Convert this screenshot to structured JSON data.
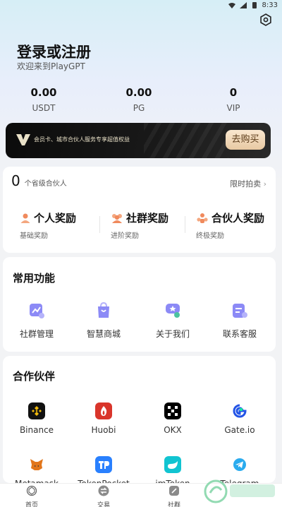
{
  "status_bar": {
    "time": "8:33"
  },
  "header": {
    "title": "登录或注册",
    "subtitle": "欢迎来到PlayGPT"
  },
  "stats": [
    {
      "value": "0.00",
      "label": "USDT"
    },
    {
      "value": "0.00",
      "label": "PG"
    },
    {
      "value": "0",
      "label": "VIP"
    }
  ],
  "banner": {
    "text": "会员卡、城市合伙人服务专享超值权益",
    "button": "去购买"
  },
  "partner": {
    "count": "0",
    "label": "个省级合伙人",
    "auction": "限时拍卖"
  },
  "rewards": [
    {
      "title": "个人奖励",
      "subtitle": "基础奖励",
      "icon": "person-icon"
    },
    {
      "title": "社群奖励",
      "subtitle": "进阶奖励",
      "icon": "group-icon"
    },
    {
      "title": "合伙人奖励",
      "subtitle": "终极奖励",
      "icon": "partners-icon"
    }
  ],
  "functions": {
    "title": "常用功能",
    "items": [
      {
        "label": "社群管理",
        "icon": "chart-icon"
      },
      {
        "label": "智慧商城",
        "icon": "shop-bag-icon"
      },
      {
        "label": "关于我们",
        "icon": "badge-icon"
      },
      {
        "label": "联系客服",
        "icon": "service-card-icon"
      }
    ]
  },
  "partners": {
    "title": "合作伙伴",
    "items": [
      {
        "label": "Binance",
        "icon": "binance-icon",
        "color": "#F0B90B"
      },
      {
        "label": "Huobi",
        "icon": "huobi-icon",
        "color": "#D9352B"
      },
      {
        "label": "OKX",
        "icon": "okx-icon",
        "color": "#000000"
      },
      {
        "label": "Gate.io",
        "icon": "gateio-icon",
        "color": "#2354E6"
      },
      {
        "label": "Metamask",
        "icon": "metamask-icon",
        "color": "#E2761B"
      },
      {
        "label": "TokenPocket",
        "icon": "tokenpocket-icon",
        "color": "#2980FE"
      },
      {
        "label": "imToken",
        "icon": "imtoken-icon",
        "color": "#11C4D1"
      },
      {
        "label": "Telegram",
        "icon": "telegram-icon",
        "color": "#2AABEE"
      }
    ]
  },
  "tabbar": [
    {
      "label": "首页",
      "icon": "home-openai-icon"
    },
    {
      "label": "交易",
      "icon": "swap-icon"
    },
    {
      "label": "社群",
      "icon": "community-icon"
    }
  ],
  "colors": {
    "accent_purple": "#6E6BF0",
    "accent_orange": "#F08A5D",
    "bg": "#F2F3F5"
  }
}
